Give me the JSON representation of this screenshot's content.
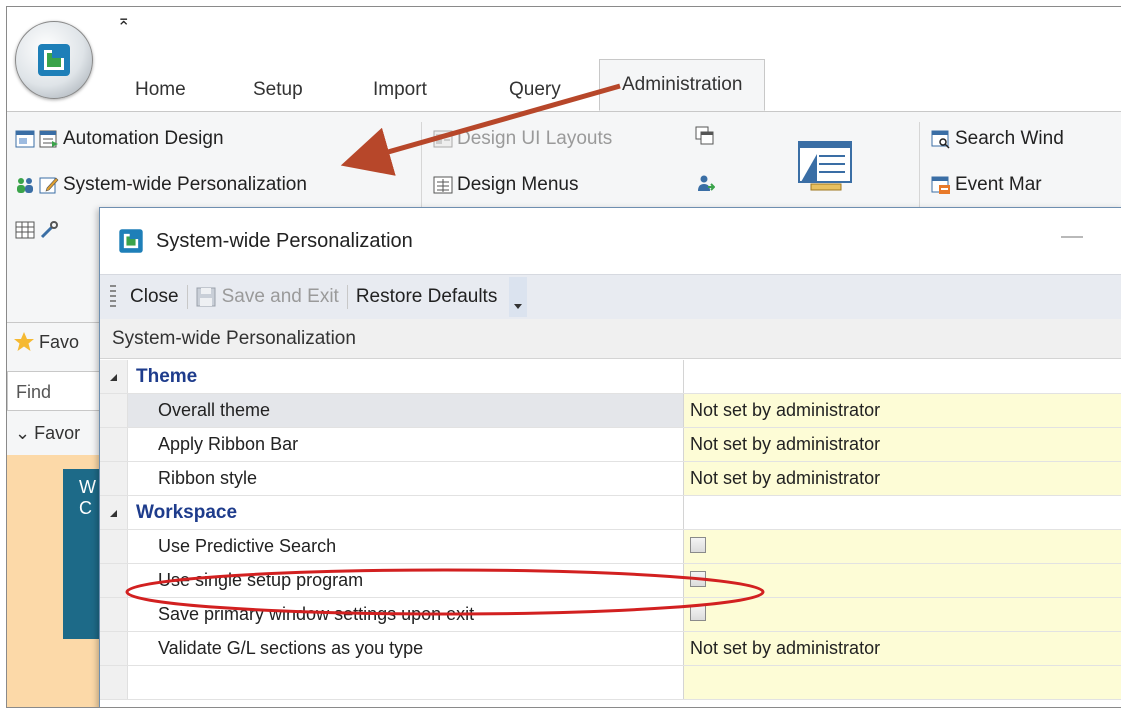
{
  "qat": {
    "arrow": "⌅"
  },
  "tabs": [
    "Home",
    "Setup",
    "Import",
    "Query",
    "Administration"
  ],
  "ribbon": {
    "automation_design": "Automation Design",
    "system_wide_personalization": "System-wide Personalization",
    "design_ui_layouts": "Design UI Layouts",
    "design_menus": "Design Menus",
    "search_windows": "Search Wind",
    "event_manager": "Event Mar"
  },
  "sidebar": {
    "favorites_bar": "Favo",
    "find": "Find",
    "favorites_section": "Favor",
    "tile_text_1": "W",
    "tile_text_2": "C"
  },
  "dialog": {
    "title": "System-wide Personalization",
    "toolbar": {
      "close": "Close",
      "save_and_exit": "Save and Exit",
      "restore_defaults": "Restore Defaults"
    },
    "grid_header": "System-wide Personalization",
    "rows": [
      {
        "label": "Theme",
        "type": "category",
        "value": ""
      },
      {
        "label": "Overall theme",
        "type": "text",
        "value": "Not set by administrator"
      },
      {
        "label": "Apply Ribbon Bar",
        "type": "text",
        "value": "Not set by administrator"
      },
      {
        "label": "Ribbon style",
        "type": "text",
        "value": "Not set by administrator"
      },
      {
        "label": "Workspace",
        "type": "category",
        "value": ""
      },
      {
        "label": "Use Predictive Search",
        "type": "checkbox",
        "value": ""
      },
      {
        "label": "Use single setup program",
        "type": "checkbox",
        "value": ""
      },
      {
        "label": "Save primary window settings upon exit",
        "type": "checkbox",
        "value": ""
      },
      {
        "label": "Validate G/L sections as you type",
        "type": "text",
        "value": "Not set by administrator"
      }
    ]
  },
  "colors": {
    "annotation_red": "#b7472a",
    "circle_red": "#d22020",
    "category_blue": "#1e3c8c",
    "value_yellow": "#fdfcd6"
  }
}
